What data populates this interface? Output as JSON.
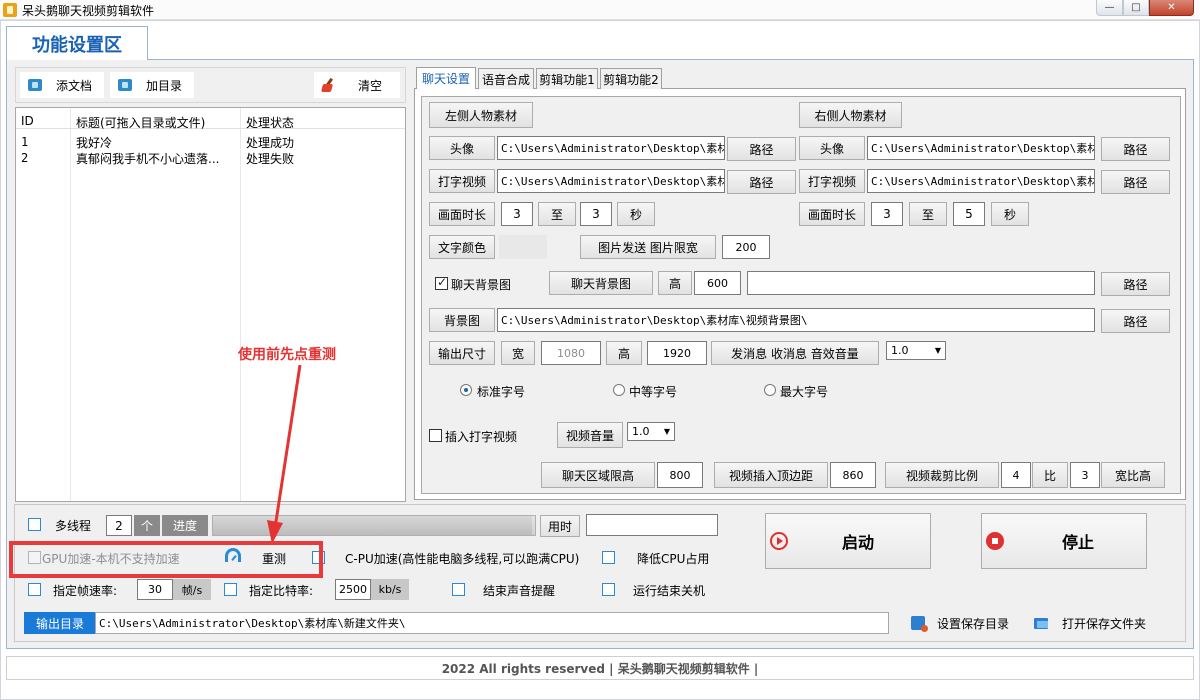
{
  "window": {
    "title": "呆头鹅聊天视频剪辑软件",
    "controls": [
      "—",
      "□",
      "✕"
    ]
  },
  "main_tab": "功能设置区",
  "left_toolbar": {
    "add_doc": "添文档",
    "add_dir": "加目录",
    "clear": "清空"
  },
  "file_list": {
    "columns": [
      "ID",
      "标题(可拖入目录或文件)",
      "处理状态"
    ],
    "rows": [
      {
        "id": "1",
        "title": "我好冷",
        "status": "处理成功"
      },
      {
        "id": "2",
        "title": "真郁闷我手机不小心遗落...",
        "status": "处理失败"
      }
    ]
  },
  "right_tabs": [
    "聊天设置",
    "语音合成",
    "剪辑功能1",
    "剪辑功能2"
  ],
  "chat": {
    "left_header": "左侧人物素材",
    "right_header": "右侧人物素材",
    "avatar": "头像",
    "typing_video": "打字视频",
    "path": "路径",
    "left_avatar_path": "C:\\Users\\Administrator\\Desktop\\素材库\\",
    "left_typing_path": "C:\\Users\\Administrator\\Desktop\\素材库\\",
    "right_avatar_path": "C:\\Users\\Administrator\\Desktop\\素材库\\",
    "right_typing_path": "C:\\Users\\Administrator\\Desktop\\素材库\\",
    "duration": "画面时长",
    "to": "至",
    "sec": "秒",
    "left_dur_from": "3",
    "left_dur_to": "3",
    "right_dur_from": "3",
    "right_dur_to": "5",
    "text_color": "文字颜色",
    "img_send_limit": "图片发送 图片限宽",
    "img_limit_value": "200",
    "chat_bg_check": "聊天背景图",
    "chat_bg_btn": "聊天背景图",
    "height": "高",
    "chat_bg_height": "600",
    "chat_bg_path": "",
    "bg_img": "背景图",
    "bg_img_path": "C:\\Users\\Administrator\\Desktop\\素材库\\视频背景图\\",
    "output_size": "输出尺寸",
    "width": "宽",
    "out_width": "1080",
    "out_height": "1920",
    "sound_label": "发消息 收消息 音效音量",
    "sound_value": "1.0",
    "font_standard": "标准字号",
    "font_medium": "中等字号",
    "font_max": "最大字号",
    "insert_typing": "插入打字视频",
    "video_volume": "视频音量",
    "video_volume_value": "1.0",
    "chat_area_width": "聊天区域限高",
    "chat_area_value": "800",
    "video_top_margin": "视频插入顶边距",
    "video_top_value": "860",
    "crop_ratio": "视频裁剪比例",
    "crop_a": "4",
    "ratio": "比",
    "crop_b": "3",
    "wh_ratio": "宽比高"
  },
  "bottom": {
    "multithread": "多线程",
    "threads": "2",
    "threads_unit": "个",
    "progress_label": "进度",
    "progress_fraction": 0.99,
    "elapsed": "用时",
    "elapsed_value": "",
    "gpu": "GPU加速-本机不支持加速",
    "retest": "重测",
    "cpu": "C-PU加速(高性能电脑多线程,可以跑满CPU)",
    "lower_cpu": "降低CPU占用",
    "fps_label": "指定帧速率:",
    "fps_value": "30",
    "fps_unit": "帧/s",
    "bitrate_label": "指定比特率:",
    "bitrate_value": "2500",
    "bitrate_unit": "kb/s",
    "end_sound": "结束声音提醒",
    "shutdown": "运行结束关机",
    "start": "启动",
    "stop": "停止",
    "out_dir_label": "输出目录",
    "out_dir_path": "C:\\Users\\Administrator\\Desktop\\素材库\\新建文件夹\\",
    "set_save_dir": "设置保存目录",
    "open_save_dir": "打开保存文件夹"
  },
  "annotation": "使用前先点重测",
  "footer": "2022 All rights reserved | 呆头鹅聊天视频剪辑软件 |"
}
